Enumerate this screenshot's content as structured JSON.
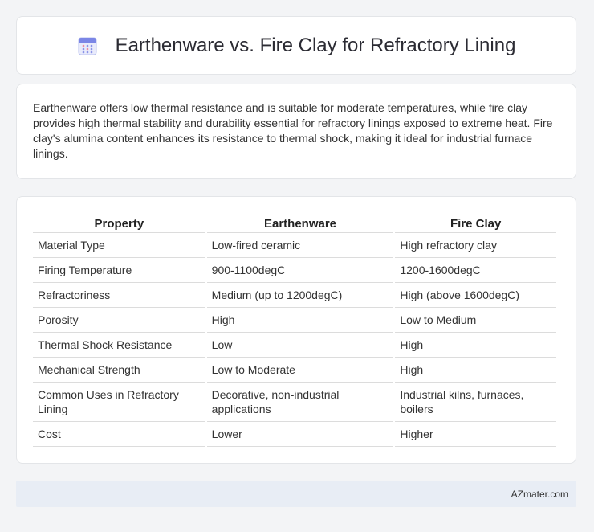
{
  "header": {
    "title": "Earthenware vs. Fire Clay for Refractory Lining",
    "icon": "calendar-icon",
    "icon_color": "#6c7ae0"
  },
  "intro": {
    "text": "Earthenware offers low thermal resistance and is suitable for moderate temperatures, while fire clay provides high thermal stability and durability essential for refractory linings exposed to extreme heat. Fire clay's alumina content enhances its resistance to thermal shock, making it ideal for industrial furnace linings."
  },
  "table": {
    "headers": [
      "Property",
      "Earthenware",
      "Fire Clay"
    ],
    "rows": [
      [
        "Material Type",
        "Low-fired ceramic",
        "High refractory clay"
      ],
      [
        "Firing Temperature",
        "900-1100degC",
        "1200-1600degC"
      ],
      [
        "Refractoriness",
        "Medium (up to 1200degC)",
        "High (above 1600degC)"
      ],
      [
        "Porosity",
        "High",
        "Low to Medium"
      ],
      [
        "Thermal Shock Resistance",
        "Low",
        "High"
      ],
      [
        "Mechanical Strength",
        "Low to Moderate",
        "High"
      ],
      [
        "Common Uses in Refractory Lining",
        "Decorative, non-industrial applications",
        "Industrial kilns, furnaces, boilers"
      ],
      [
        "Cost",
        "Lower",
        "Higher"
      ]
    ]
  },
  "footer": {
    "brand": "AZmater.com"
  }
}
